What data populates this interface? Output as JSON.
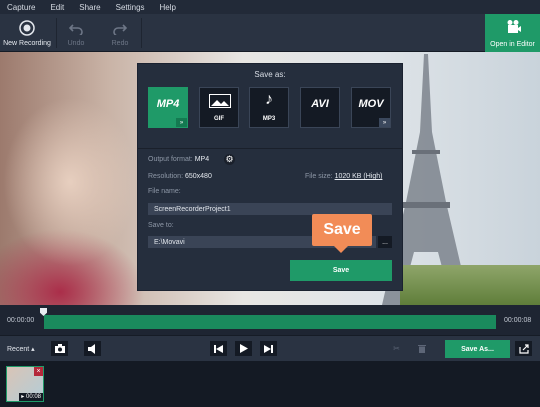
{
  "menu": [
    "Capture",
    "Edit",
    "Share",
    "Settings",
    "Help"
  ],
  "toolbar": {
    "new_recording": "New Recording",
    "undo": "Undo",
    "redo": "Redo",
    "open_in_editor": "Open in Editor"
  },
  "dialog": {
    "title": "Save as:",
    "formats": [
      {
        "label": "MP4",
        "selected": true
      },
      {
        "label": "GIF",
        "selected": false
      },
      {
        "label": "MP3",
        "selected": false
      },
      {
        "label": "AVI",
        "selected": false
      },
      {
        "label": "MOV",
        "selected": false
      }
    ],
    "output_format_label": "Output format:",
    "output_format_value": "MP4",
    "resolution_label": "Resolution:",
    "resolution_value": "650x480",
    "file_size_label": "File size:",
    "file_size_value": "1020 KB (High)",
    "file_name_label": "File name:",
    "file_name_value": "ScreenRecorderProject1",
    "save_to_label": "Save to:",
    "save_to_value": "E:\\Movavi",
    "browse_label": "...",
    "save_button": "Save"
  },
  "callout": "Save",
  "timeline": {
    "start": "00:00:00",
    "end": "00:00:08"
  },
  "controls": {
    "recent": "Recent",
    "save_as": "Save As..."
  },
  "recent_item": {
    "duration": "00:08"
  },
  "colors": {
    "accent": "#1f9a68",
    "callout": "#f28c57"
  }
}
